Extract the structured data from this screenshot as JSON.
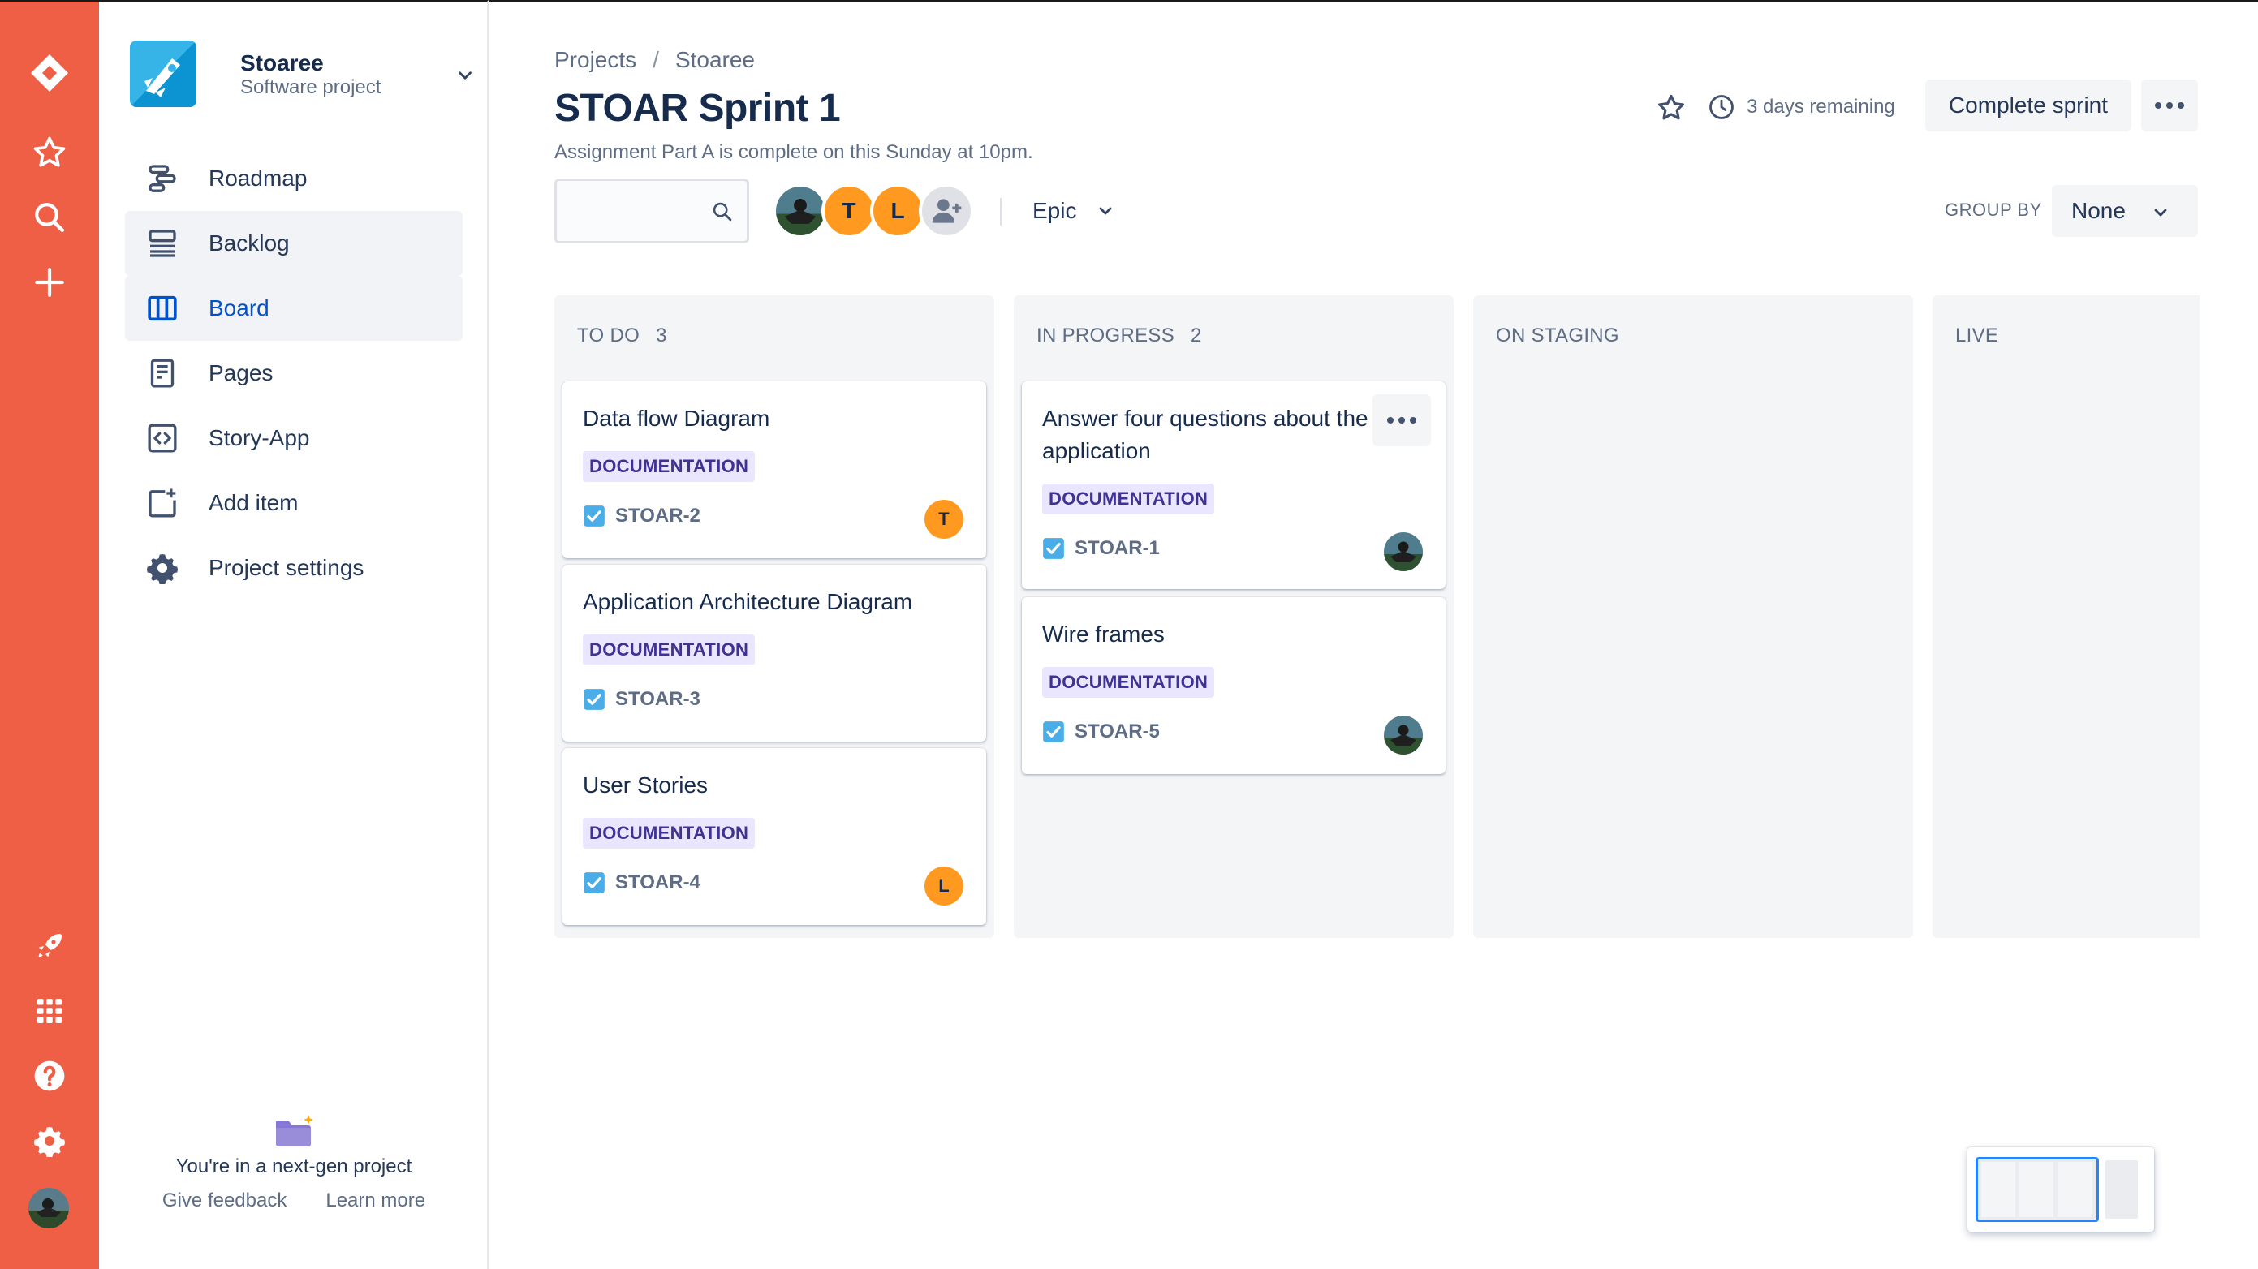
{
  "project": {
    "name": "Stoaree",
    "type": "Software project"
  },
  "nav": {
    "items": [
      {
        "label": "Roadmap",
        "icon": "roadmap-icon"
      },
      {
        "label": "Backlog",
        "icon": "backlog-icon"
      },
      {
        "label": "Board",
        "icon": "board-icon"
      },
      {
        "label": "Pages",
        "icon": "pages-icon"
      },
      {
        "label": "Story-App",
        "icon": "code-icon"
      },
      {
        "label": "Add item",
        "icon": "add-item-icon"
      },
      {
        "label": "Project settings",
        "icon": "gear-icon"
      }
    ],
    "active": "Board",
    "highlighted": "Backlog"
  },
  "sidebar_footer": {
    "message": "You're in a next-gen project",
    "give_feedback": "Give feedback",
    "learn_more": "Learn more"
  },
  "breadcrumbs": [
    "Projects",
    "Stoaree"
  ],
  "sprint": {
    "title": "STOAR Sprint 1",
    "goal": "Assignment Part A is complete on this Sunday at 10pm.",
    "remaining": "3 days remaining",
    "complete_label": "Complete sprint"
  },
  "filters": {
    "search_placeholder": "",
    "avatars": [
      {
        "type": "photo"
      },
      {
        "type": "initial",
        "text": "T"
      },
      {
        "type": "initial",
        "text": "L"
      },
      {
        "type": "add-person"
      }
    ],
    "epic_label": "Epic",
    "group_by_label": "GROUP BY",
    "group_by_value": "None"
  },
  "columns": [
    {
      "name": "TO DO",
      "count": "3",
      "cards": [
        {
          "title": "Data flow Diagram",
          "label": "DOCUMENTATION",
          "key": "STOAR-2",
          "assignee": "T"
        },
        {
          "title": "Application Architecture Diagram",
          "label": "DOCUMENTATION",
          "key": "STOAR-3",
          "assignee": ""
        },
        {
          "title": "User Stories",
          "label": "DOCUMENTATION",
          "key": "STOAR-4",
          "assignee": "L"
        }
      ]
    },
    {
      "name": "IN PROGRESS",
      "count": "2",
      "cards": [
        {
          "title_line1": "Answer four questions about the",
          "title_line2": "application",
          "label": "DOCUMENTATION",
          "key": "STOAR-1",
          "assignee": "photo"
        },
        {
          "title": "Wire frames",
          "label": "DOCUMENTATION",
          "key": "STOAR-5",
          "assignee": "photo"
        }
      ]
    },
    {
      "name": "ON STAGING",
      "count": "",
      "cards": []
    },
    {
      "name": "LIVE",
      "count": "",
      "cards": []
    }
  ],
  "colors": {
    "rail": "#ee5f45",
    "active_nav": "#0052cc",
    "lozenge_bg": "#eae6ff",
    "lozenge_text": "#403294",
    "initial_avatar": "#ff991f",
    "checkbox": "#4bade8"
  }
}
